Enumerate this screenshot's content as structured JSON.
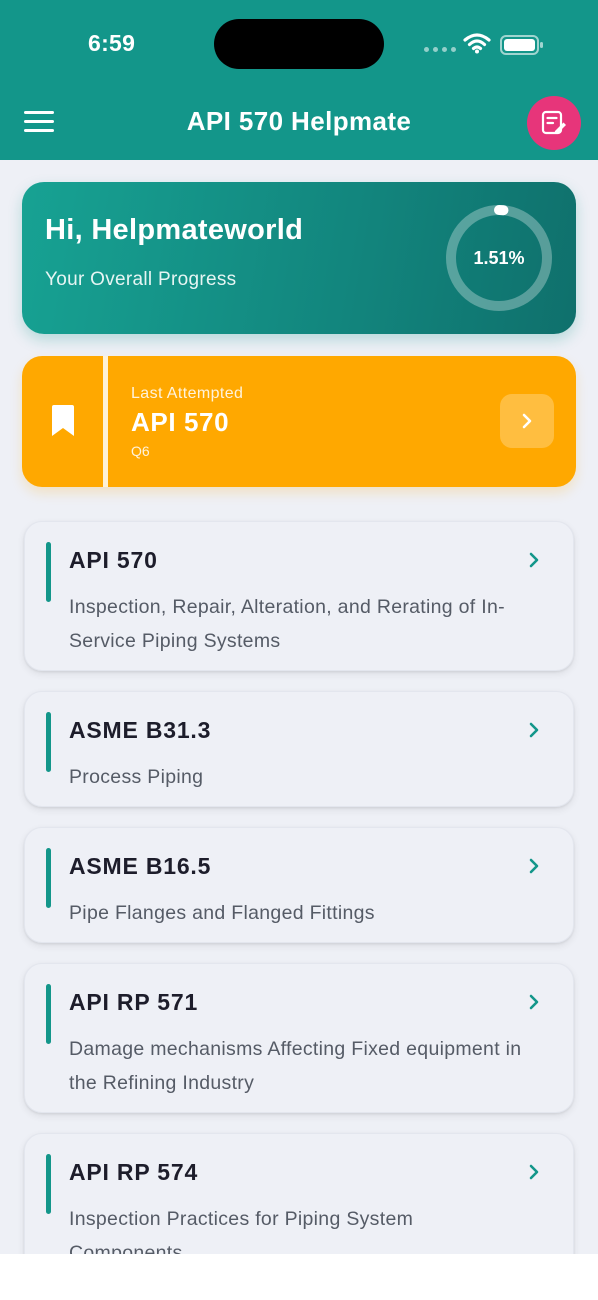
{
  "status_bar": {
    "time": "6:59"
  },
  "header": {
    "title": "API 570 Helpmate",
    "menu_icon": "hamburger-menu-icon",
    "notes_icon": "edit-notes-icon",
    "colors": {
      "background": "#13968a",
      "notes_button": "#e7357a"
    }
  },
  "progress": {
    "greeting": "Hi, Helpmateworld",
    "label": "Your Overall Progress",
    "percent_text": "1.51%",
    "percent_value": 1.51
  },
  "last_attempted": {
    "label": "Last Attempted",
    "title": "API 570",
    "question": "Q6",
    "icon": "bookmark-icon",
    "color": "#ffa800"
  },
  "books": [
    {
      "title": "API 570",
      "description": "Inspection, Repair, Alteration, and Rerating of In-Service Piping Systems"
    },
    {
      "title": "ASME B31.3",
      "description": "Process Piping"
    },
    {
      "title": "ASME B16.5",
      "description": "Pipe Flanges and Flanged Fittings"
    },
    {
      "title": "API RP 571",
      "description": "Damage mechanisms Affecting Fixed equipment in the Refining Industry"
    },
    {
      "title": "API RP 574",
      "description": "Inspection Practices for Piping System Components"
    }
  ]
}
